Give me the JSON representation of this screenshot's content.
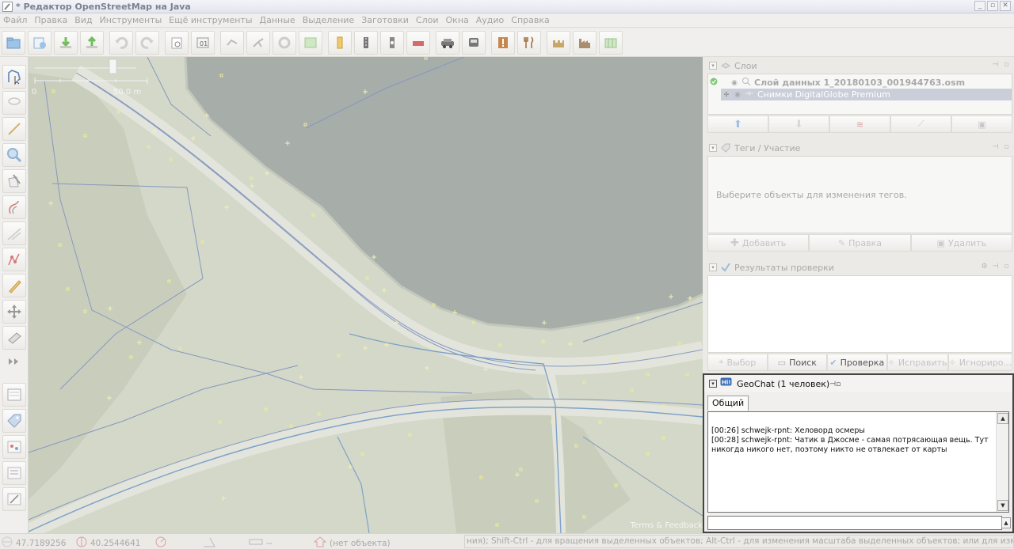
{
  "window": {
    "title": "* Редактор OpenStreetMap на Java",
    "controls": [
      "_",
      "▫",
      "✕"
    ]
  },
  "menu": [
    "Файл",
    "Правка",
    "Вид",
    "Инструменты",
    "Ещё инструменты",
    "Данные",
    "Выделение",
    "Заготовки",
    "Слои",
    "Окна",
    "Аудио",
    "Справка"
  ],
  "toolbar_icons": [
    "open-file-icon",
    "open-location-icon",
    "download-icon",
    "upload-icon",
    "undo-icon",
    "redo-icon",
    "preferences-icon",
    "save-as-icon",
    "zoom-to-selection-icon",
    "merge-icon",
    "refresh-icon",
    "validate-icon",
    "traffic-light-icon",
    "road-icon",
    "traffic-signal-icon",
    "barrier-icon",
    "car-icon",
    "bus-icon",
    "warning-icon",
    "restaurant-icon",
    "castle-icon",
    "factory-icon",
    "map-tile-icon"
  ],
  "left_tool_icons": [
    "select-icon",
    "lasso-icon",
    "draw-icon",
    "zoom-icon",
    "delete-icon",
    "parallel-icon",
    "improve-way-icon",
    "split-icon",
    "pencil-icon",
    "move-icon",
    "buildings-icon",
    "more-icon",
    "toggle-panel-icon",
    "tag-icon",
    "validator-icon",
    "filter-icon",
    "ruler-icon"
  ],
  "map": {
    "scale": {
      "start": "0",
      "end": "50.0 m"
    },
    "attribution": "Terms & Feedback"
  },
  "layers_panel": {
    "title": "Слои",
    "layers": [
      {
        "name": "Слой данных 1_20180103_001944763.osm",
        "active": true
      },
      {
        "name": "Снимки DigitalGlobe Premium",
        "active": false
      }
    ]
  },
  "tags_panel": {
    "title": "Теги / Участие",
    "empty_message": "Выберите объекты для изменения тегов.",
    "buttons": [
      "Добавить",
      "Правка",
      "Удалить"
    ]
  },
  "validation_panel": {
    "title": "Результаты проверки",
    "buttons": [
      "Выбор",
      "Поиск",
      "Проверка",
      "Исправить",
      "Игнориро..."
    ]
  },
  "geochat": {
    "title": "GeoChat (1 человек)",
    "tab": "Общий",
    "messages": [
      "[00:26] schwejk-rpnt: Хеловорд осмеры",
      "[00:28] schwejk-rpnt: Чатик в Джосме - самая потрясающая вещь. Тут никогда никого нет, поэтому никто не отвлекает от карты"
    ]
  },
  "status": {
    "lat": "47.7189256",
    "lon": "40.2544641",
    "angle": "",
    "distance": "--",
    "object": "(нет объекта)",
    "help": "ния); Shift-Ctrl - для вращения выделенных объектов; Alt-Ctrl - для изменения масштаба выделенных объектов; или для изменения выделения"
  },
  "colors": {
    "water": "#a5aca8",
    "land": "#cfd5c3",
    "road": "#e4e6de",
    "way_blue": "#7e94bd",
    "node_yellow": "#f3ef9a"
  }
}
